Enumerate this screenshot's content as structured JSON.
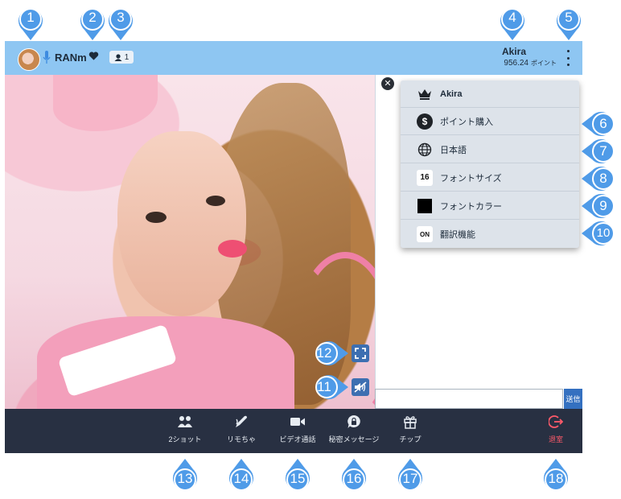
{
  "header": {
    "streamer_name": "RANm",
    "viewer_count": "1",
    "user_name": "Akira",
    "user_points": "956.24",
    "points_unit": "ポイント"
  },
  "menu": {
    "items": [
      {
        "label": "Akira",
        "icon": "crown-icon"
      },
      {
        "label": "ポイント購入",
        "icon": "dollar-icon",
        "glyph": "$"
      },
      {
        "label": "日本語",
        "icon": "globe-icon"
      },
      {
        "label": "フォントサイズ",
        "icon": "font-size-icon",
        "glyph": "16"
      },
      {
        "label": "フォントカラー",
        "icon": "font-color-swatch",
        "color": "#000000"
      },
      {
        "label": "翻訳機能",
        "icon": "translate-toggle-icon",
        "glyph": "ON"
      }
    ]
  },
  "chat": {
    "close_glyph": "✕",
    "input_value": "",
    "send_label": "送信"
  },
  "toolbar": {
    "items": [
      {
        "label": "2ショット",
        "icon": "two-shot-icon"
      },
      {
        "label": "リモちゃ",
        "icon": "remote-toy-icon"
      },
      {
        "label": "ビデオ通話",
        "icon": "video-call-icon"
      },
      {
        "label": "秘密メッセージ",
        "icon": "secret-message-icon"
      },
      {
        "label": "チップ",
        "icon": "gift-icon"
      },
      {
        "label": "退室",
        "icon": "exit-icon"
      }
    ]
  },
  "callouts": [
    "1",
    "2",
    "3",
    "4",
    "5",
    "6",
    "7",
    "8",
    "9",
    "10",
    "11",
    "12",
    "13",
    "14",
    "15",
    "16",
    "17",
    "18"
  ],
  "colors": {
    "header_bg": "#8ec6f2",
    "callout": "#4f9be8",
    "toolbar_bg": "#283042",
    "exit_red": "#ff5a6a",
    "send_blue": "#3470c0"
  }
}
